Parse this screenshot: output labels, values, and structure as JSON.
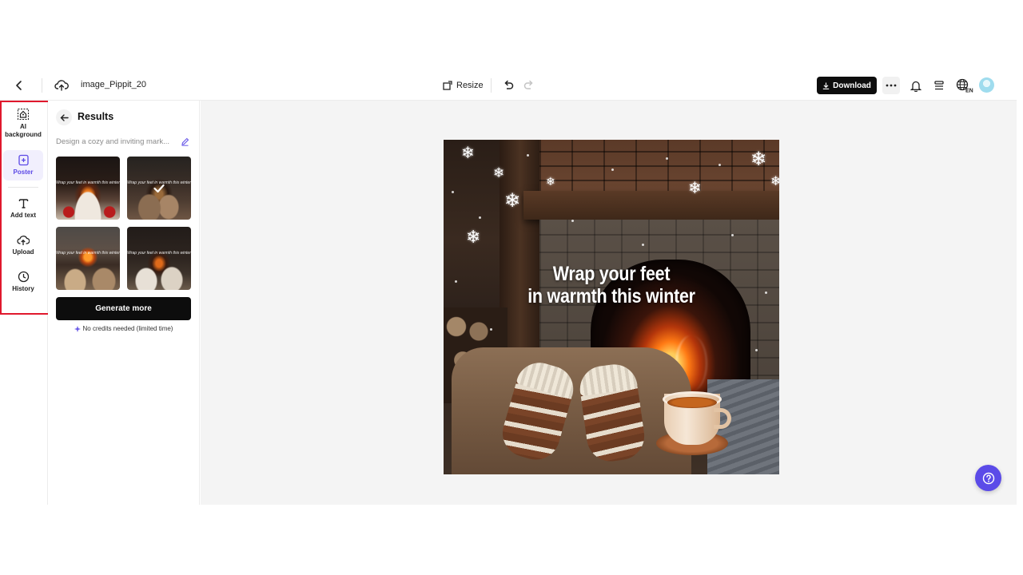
{
  "topbar": {
    "filename": "image_Pippit_20",
    "resize_label": "Resize",
    "download_label": "Download",
    "lang_code": "EN"
  },
  "rail": {
    "items": [
      {
        "label": "AI background",
        "icon": "ai-background-icon"
      },
      {
        "label": "Poster",
        "icon": "poster-icon",
        "active": true
      },
      {
        "label": "Add text",
        "icon": "text-icon"
      },
      {
        "label": "Upload",
        "icon": "upload-icon"
      },
      {
        "label": "History",
        "icon": "history-icon"
      }
    ],
    "highlight_color": "#e0182d"
  },
  "panel": {
    "title": "Results",
    "prompt": "Design a cozy and inviting mark...",
    "thumbnails": [
      {
        "caption": "Wrap your feet in warmth this winter",
        "selected": false
      },
      {
        "caption": "Wrap your feet in warmth this winter",
        "selected": true
      },
      {
        "caption": "Wrap your feet in warmth this winter",
        "selected": false
      },
      {
        "caption": "Wrap your feet in warmth this winter",
        "selected": false
      }
    ],
    "generate_label": "Generate more",
    "credits_note": "No credits needed (limited time)"
  },
  "canvas": {
    "poster_line1": "Wrap your feet",
    "poster_line2": "in warmth this winter"
  },
  "colors": {
    "accent": "#5b4be8",
    "primary_button": "#0d0d0d",
    "canvas_bg": "#f4f4f4"
  }
}
